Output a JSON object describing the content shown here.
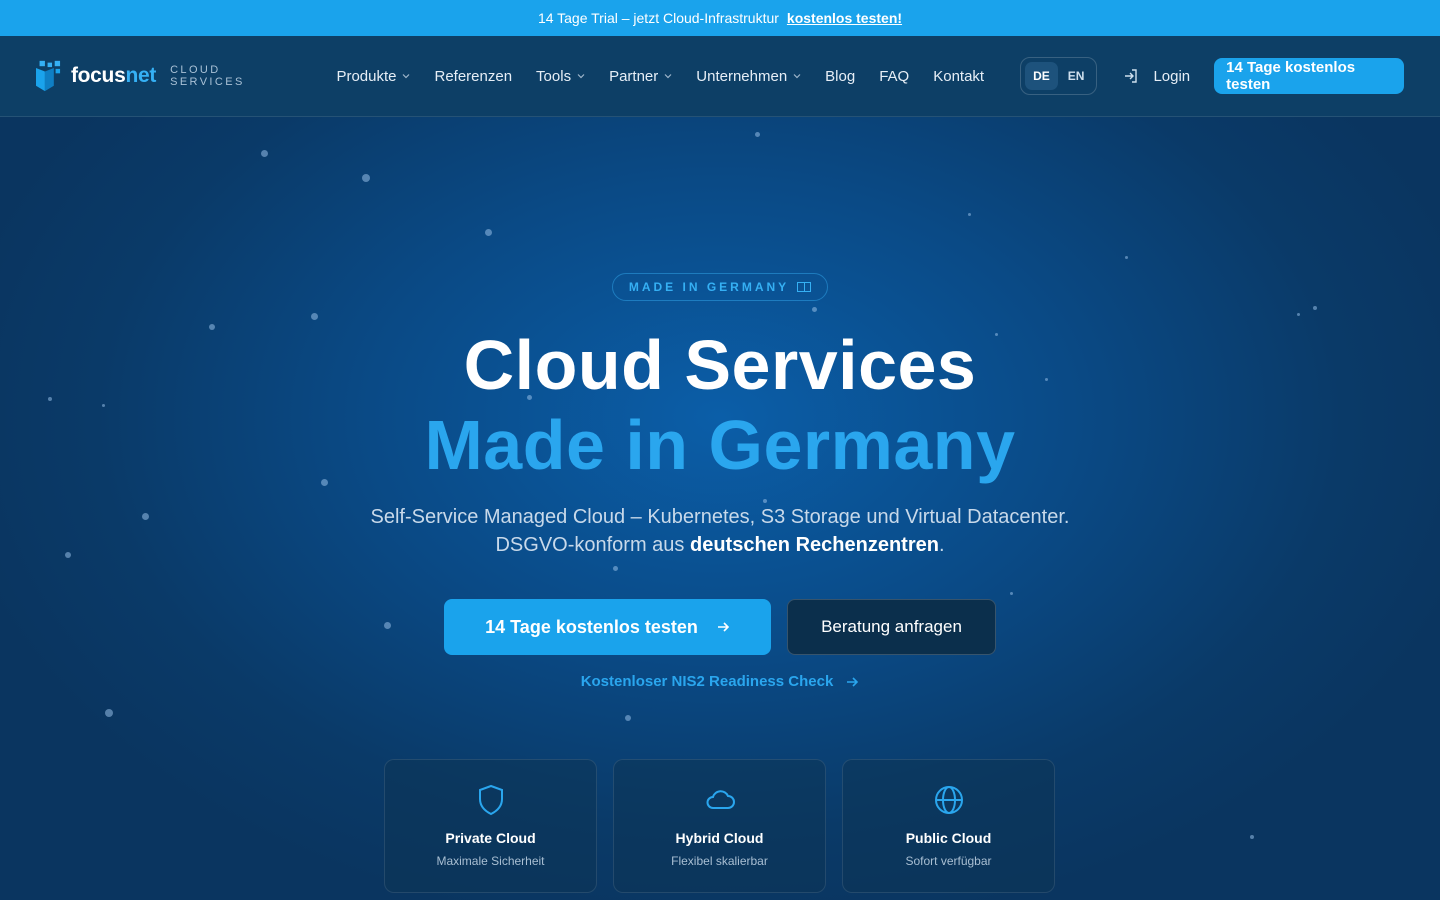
{
  "topbar": {
    "text": "14 Tage Trial – jetzt Cloud-Infrastruktur",
    "link": "kostenlos testen!"
  },
  "header": {
    "logo_main": "focus",
    "logo_accent": "net",
    "logo_sub": "CLOUD SERVICES",
    "nav": [
      {
        "label": "Produkte",
        "has_dropdown": true
      },
      {
        "label": "Referenzen",
        "has_dropdown": false
      },
      {
        "label": "Tools",
        "has_dropdown": true
      },
      {
        "label": "Partner",
        "has_dropdown": true
      },
      {
        "label": "Unternehmen",
        "has_dropdown": true
      },
      {
        "label": "Blog",
        "has_dropdown": false
      },
      {
        "label": "FAQ",
        "has_dropdown": false
      },
      {
        "label": "Kontakt",
        "has_dropdown": false
      }
    ],
    "languages": [
      {
        "code": "DE",
        "active": true
      },
      {
        "code": "EN",
        "active": false
      }
    ],
    "login_label": "Login",
    "cta_label": "14 Tage kostenlos testen"
  },
  "hero": {
    "badge": "MADE IN GERMANY",
    "title_line1": "Cloud Services",
    "title_line2": "Made in Germany",
    "subtitle_plain": "Self-Service Managed Cloud – Kubernetes, S3 Storage und Virtual Datacenter. DSGVO-konform aus ",
    "subtitle_bold": "deutschen Rechenzentren",
    "subtitle_end": ".",
    "primary_cta": "14 Tage kostenlos testen",
    "secondary_cta": "Beratung anfragen",
    "nis2_link": "Kostenloser NIS2 Readiness Check"
  },
  "cards": [
    {
      "title": "Private Cloud",
      "subtitle": "Maximale Sicherheit",
      "icon": "shield-icon"
    },
    {
      "title": "Hybrid Cloud",
      "subtitle": "Flexibel skalierbar",
      "icon": "cloud-icon"
    },
    {
      "title": "Public Cloud",
      "subtitle": "Sofort verfügbar",
      "icon": "globe-icon"
    }
  ],
  "colors": {
    "accent": "#1aa3ec",
    "headline_accent": "#2aa6ee",
    "background": "#0a4a86",
    "header": "#0d3f66"
  }
}
